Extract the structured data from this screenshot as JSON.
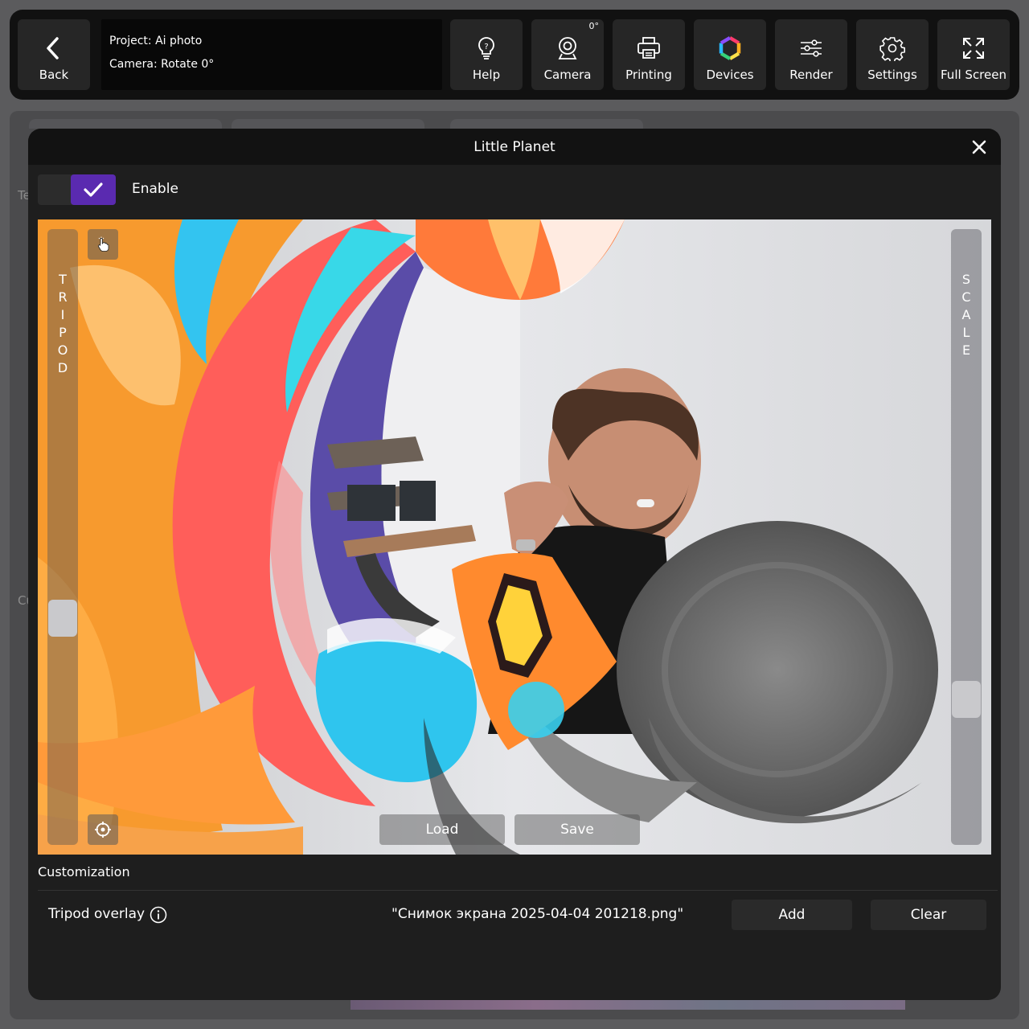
{
  "toolbar": {
    "back_label": "Back",
    "project_line": "Project: Ai photo",
    "camera_line": "Camera: Rotate 0°",
    "camera_rotation_badge": "0°",
    "buttons": [
      {
        "label": "Help",
        "icon": "lightbulb-icon"
      },
      {
        "label": "Camera",
        "icon": "webcam-icon"
      },
      {
        "label": "Printing",
        "icon": "printer-icon"
      },
      {
        "label": "Devices",
        "icon": "devices-ring-icon"
      },
      {
        "label": "Render",
        "icon": "sliders-icon"
      },
      {
        "label": "Settings",
        "icon": "gear-icon"
      },
      {
        "label": "Full Screen",
        "icon": "expand-icon"
      }
    ]
  },
  "background": {
    "label_1": "Te",
    "label_2": "Cu"
  },
  "modal": {
    "title": "Little Planet",
    "enable_label": "Enable",
    "enabled": true,
    "tripod_label": "TRIPOD",
    "scale_label": "SCALE",
    "tripod_slider_value": 0.36,
    "scale_slider_value": 0.22,
    "load_label": "Load",
    "save_label": "Save",
    "customization_label": "Customization",
    "tripod_overlay_label": "Tripod overlay",
    "tripod_overlay_file": "\"Снимок экрана 2025-04-04 201218.png\"",
    "add_label": "Add",
    "clear_label": "Clear"
  },
  "colors": {
    "accent": "#5a2ab0",
    "modal_bg": "#1e1e1e",
    "toolbar_bg": "#111111",
    "button_bg": "#262626"
  }
}
